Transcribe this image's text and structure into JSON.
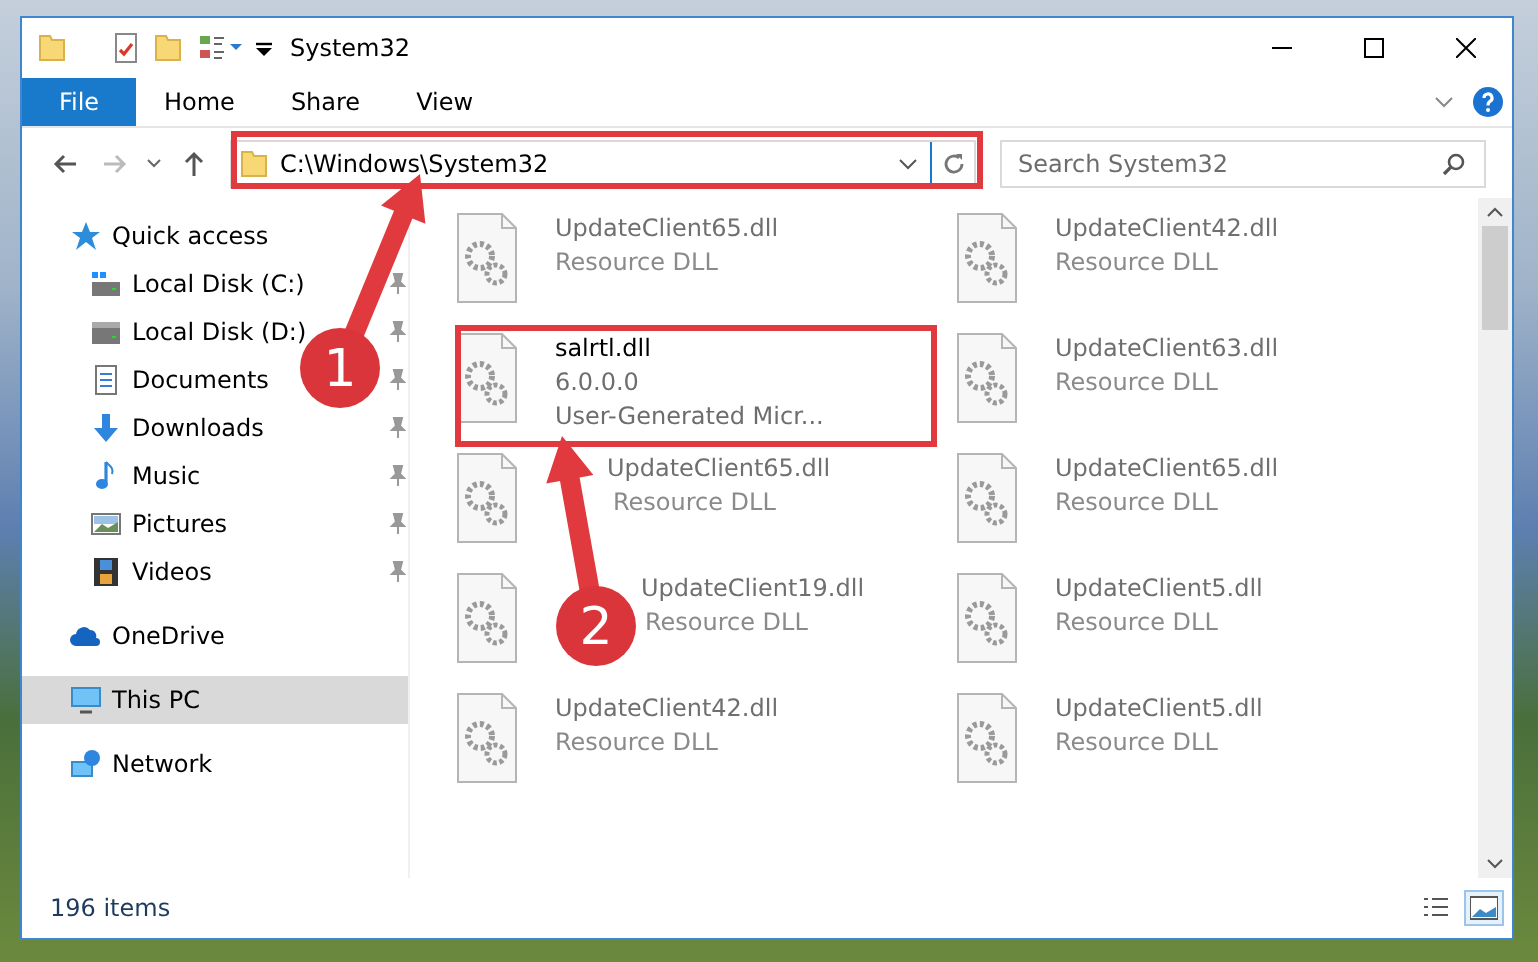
{
  "window": {
    "title": "System32"
  },
  "ribbon_tabs": [
    {
      "label": "File",
      "kind": "menu"
    },
    {
      "label": "Home",
      "kind": "tab"
    },
    {
      "label": "Share",
      "kind": "tab"
    },
    {
      "label": "View",
      "kind": "tab"
    }
  ],
  "address_bar": {
    "path": "C:\\Windows\\System32",
    "highlighted": true
  },
  "search": {
    "placeholder": "Search System32"
  },
  "navigation": [
    {
      "label": "Quick access",
      "kind": "star",
      "selected": false,
      "children": [
        {
          "label": "Local Disk (C:)",
          "kind": "system",
          "pinned": true,
          "selected": false
        },
        {
          "label": "Local Disk (D:)",
          "kind": "drive",
          "pinned": true,
          "selected": false
        },
        {
          "label": "Documents",
          "kind": "documents",
          "pinned": true,
          "selected": false
        },
        {
          "label": "Downloads",
          "kind": "downloads",
          "pinned": true,
          "selected": false
        },
        {
          "label": "Music",
          "kind": "music",
          "pinned": true,
          "selected": false
        },
        {
          "label": "Pictures",
          "kind": "pictures",
          "pinned": true,
          "selected": false
        },
        {
          "label": "Videos",
          "kind": "videos",
          "pinned": true,
          "selected": false
        }
      ]
    },
    {
      "label": "OneDrive",
      "kind": "cloud",
      "selected": false
    },
    {
      "label": "This PC",
      "kind": "computer",
      "selected": true
    },
    {
      "label": "Network",
      "kind": "network",
      "selected": false
    }
  ],
  "files": [
    {
      "name": "UpdateClient65.dll",
      "details": [
        "Resource DLL"
      ],
      "blurred": true,
      "highlighted": false
    },
    {
      "name": "UpdateClient42.dll",
      "details": [
        "Resource DLL"
      ],
      "blurred": true,
      "highlighted": false
    },
    {
      "name": "salrtl.dll",
      "details": [
        "6.0.0.0",
        "User-Generated Micr..."
      ],
      "blurred": false,
      "highlighted": true
    },
    {
      "name": "UpdateClient63.dll",
      "details": [
        "Resource DLL"
      ],
      "blurred": true,
      "highlighted": false
    },
    {
      "name": "UpdateClient65.dll",
      "details": [
        "Resource DLL"
      ],
      "blurred": true,
      "highlighted": false
    },
    {
      "name": "UpdateClient65.dll",
      "details": [
        "Resource DLL"
      ],
      "blurred": true,
      "highlighted": false
    },
    {
      "name": "UpdateClient19.dll",
      "details": [
        "Resource DLL"
      ],
      "blurred": true,
      "highlighted": false
    },
    {
      "name": "UpdateClient5.dll",
      "details": [
        "Resource DLL"
      ],
      "blurred": true,
      "highlighted": false
    },
    {
      "name": "UpdateClient42.dll",
      "details": [
        "Resource DLL"
      ],
      "blurred": true,
      "highlighted": false
    },
    {
      "name": "UpdateClient5.dll",
      "details": [
        "Resource DLL"
      ],
      "blurred": true,
      "highlighted": false
    }
  ],
  "annotations": [
    {
      "number": "1"
    },
    {
      "number": "2"
    }
  ],
  "status_bar": {
    "item_count": "196 items",
    "views": [
      {
        "kind": "details",
        "selected": false
      },
      {
        "kind": "icons",
        "selected": true
      }
    ]
  }
}
